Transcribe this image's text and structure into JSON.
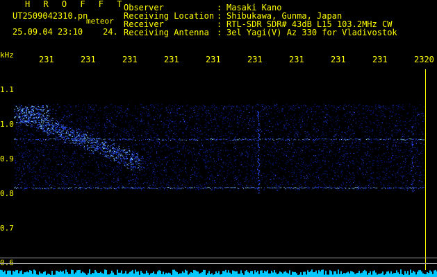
{
  "header": {
    "brand": "H R O F F T",
    "filename": "UT2509042310.pn",
    "filename_suffix": "meteor",
    "datetime": "25.09.04 23:10",
    "value_short": "24.",
    "meta_labels": "Observer\nReceiving Location\nReceiver\nReceiving Antenna",
    "meta_colons": ":\n:\n:\n:",
    "meta_values": "Masaki Kano\nShibukawa, Gunma, Japan\nRTL-SDR SDR# 43dB L15 103.2MHz CW\n3el Yagi(V) Az 330 for Vladivostok"
  },
  "axes": {
    "y_unit": "kHz",
    "x_ticks": [
      "231",
      "231",
      "231",
      "231",
      "231",
      "231",
      "231",
      "231",
      "231",
      "2320"
    ],
    "y_ticks": [
      "1.1",
      "1.0",
      "0.9",
      "0.8",
      "0.7",
      "0.6"
    ]
  },
  "colors": {
    "text": "#ffff00",
    "background": "#000000",
    "signal_dim": "#0a1a8c",
    "signal_mid": "#2a50ff",
    "signal_bright": "#8ad8ff",
    "baseline": "#00c8ff"
  }
}
